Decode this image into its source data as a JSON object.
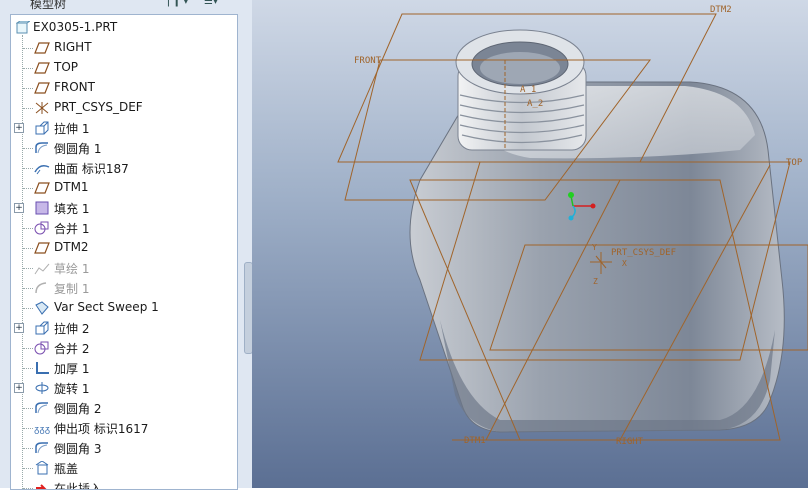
{
  "panel": {
    "title": "模型树"
  },
  "tree": {
    "root": "EX0305-1.PRT",
    "items": [
      {
        "label": "RIGHT",
        "icon": "datum-plane-icon",
        "expand": false,
        "dim": false
      },
      {
        "label": "TOP",
        "icon": "datum-plane-icon",
        "expand": false,
        "dim": false
      },
      {
        "label": "FRONT",
        "icon": "datum-plane-icon",
        "expand": false,
        "dim": false
      },
      {
        "label": "PRT_CSYS_DEF",
        "icon": "csys-icon",
        "expand": false,
        "dim": false
      },
      {
        "label": "拉伸 1",
        "icon": "extrude-icon",
        "expand": true,
        "dim": false
      },
      {
        "label": "倒圆角 1",
        "icon": "round-icon",
        "expand": false,
        "dim": false
      },
      {
        "label": "曲面 标识187",
        "icon": "surface-icon",
        "expand": false,
        "dim": false
      },
      {
        "label": "DTM1",
        "icon": "datum-plane-icon",
        "expand": false,
        "dim": false
      },
      {
        "label": "填充 1",
        "icon": "fill-icon",
        "expand": true,
        "dim": false
      },
      {
        "label": "合并 1",
        "icon": "merge-icon",
        "expand": false,
        "dim": false
      },
      {
        "label": "DTM2",
        "icon": "datum-plane-icon",
        "expand": false,
        "dim": false
      },
      {
        "label": "草绘 1",
        "icon": "sketch-icon",
        "expand": false,
        "dim": true
      },
      {
        "label": "复制 1",
        "icon": "copy-icon",
        "expand": false,
        "dim": true
      },
      {
        "label": "Var Sect Sweep 1",
        "icon": "sweep-icon",
        "expand": false,
        "dim": false
      },
      {
        "label": "拉伸 2",
        "icon": "extrude-icon",
        "expand": true,
        "dim": false
      },
      {
        "label": "合并 2",
        "icon": "merge-icon",
        "expand": false,
        "dim": false
      },
      {
        "label": "加厚 1",
        "icon": "thicken-icon",
        "expand": false,
        "dim": false
      },
      {
        "label": "旋转 1",
        "icon": "revolve-icon",
        "expand": true,
        "dim": false
      },
      {
        "label": "倒圆角 2",
        "icon": "round-icon",
        "expand": false,
        "dim": false
      },
      {
        "label": "伸出项 标识1617",
        "icon": "protrusion-icon",
        "expand": false,
        "dim": false
      },
      {
        "label": "倒圆角 3",
        "icon": "round-icon",
        "expand": false,
        "dim": false
      },
      {
        "label": "瓶盖",
        "icon": "cap-icon",
        "expand": false,
        "dim": false
      },
      {
        "label": "在此插入",
        "icon": "insert-here-icon",
        "expand": false,
        "dim": false
      }
    ]
  },
  "viewport": {
    "labels": {
      "dtm2": "DTM2",
      "front": "FRONT",
      "top": "TOP",
      "dtm1": "DTM1",
      "right": "RIGHT",
      "csys": "PRT_CSYS_DEF",
      "axis1": "A_1",
      "axis2": "A_2",
      "csys_x": "X",
      "csys_y": "Y",
      "csys_z": "Z"
    },
    "colors": {
      "datum": "#a0642a",
      "body": "#8d96a4"
    }
  }
}
